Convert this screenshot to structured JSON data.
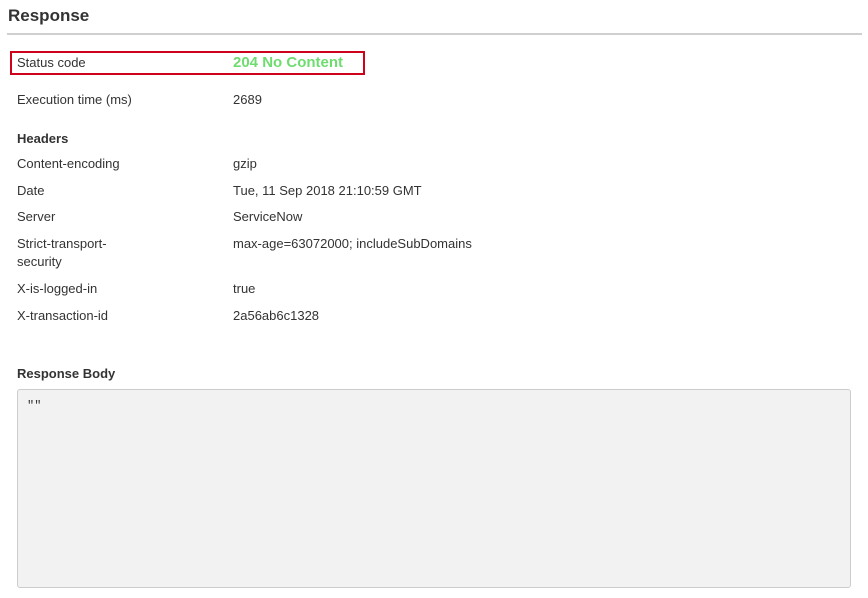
{
  "response": {
    "title": "Response",
    "status": {
      "label": "Status code",
      "value": "204 No Content",
      "value_color": "#6fdc6f",
      "highlight_color": "#d0021b"
    },
    "execution_time": {
      "label": "Execution time (ms)",
      "value": "2689"
    },
    "headers": {
      "heading": "Headers",
      "rows": [
        {
          "name": "Content-encoding",
          "value": "gzip"
        },
        {
          "name": "Date",
          "value": "Tue, 11 Sep 2018 21:10:59 GMT"
        },
        {
          "name": "Server",
          "value": "ServiceNow"
        },
        {
          "name": "Strict-transport-security",
          "value": "max-age=63072000; includeSubDomains"
        },
        {
          "name": "X-is-logged-in",
          "value": "true"
        },
        {
          "name": "X-transaction-id",
          "value": "2a56ab6c1328"
        }
      ]
    },
    "body": {
      "heading": "Response Body",
      "content": "\"\""
    }
  }
}
